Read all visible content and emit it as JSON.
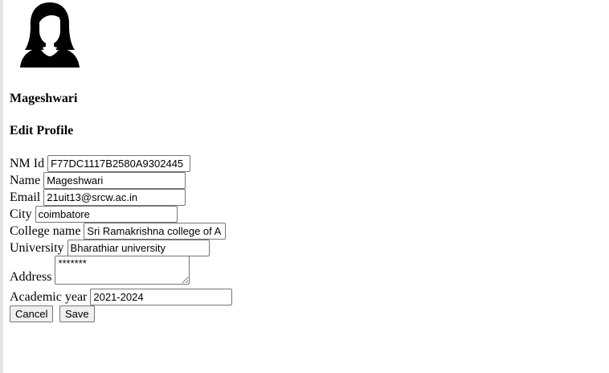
{
  "profile": {
    "name": "Mageshwari",
    "avatar_icon": "user-avatar-female-icon"
  },
  "form": {
    "title": "Edit Profile",
    "fields": {
      "nm_id": {
        "label": "NM Id",
        "value": "F77DC1117B2580A9302445"
      },
      "name": {
        "label": "Name",
        "value": "Mageshwari"
      },
      "email": {
        "label": "Email",
        "value": "21uit13@srcw.ac.in"
      },
      "city": {
        "label": "City",
        "value": "coimbatore"
      },
      "college": {
        "label": "College name",
        "value": "Sri Ramakrishna college of A"
      },
      "university": {
        "label": "University",
        "value": "Bharathiar university"
      },
      "address": {
        "label": "Address",
        "value": "*******"
      },
      "academic_year": {
        "label": "Academic year",
        "value": "2021-2024"
      }
    },
    "buttons": {
      "cancel": "Cancel",
      "save": "Save"
    }
  }
}
